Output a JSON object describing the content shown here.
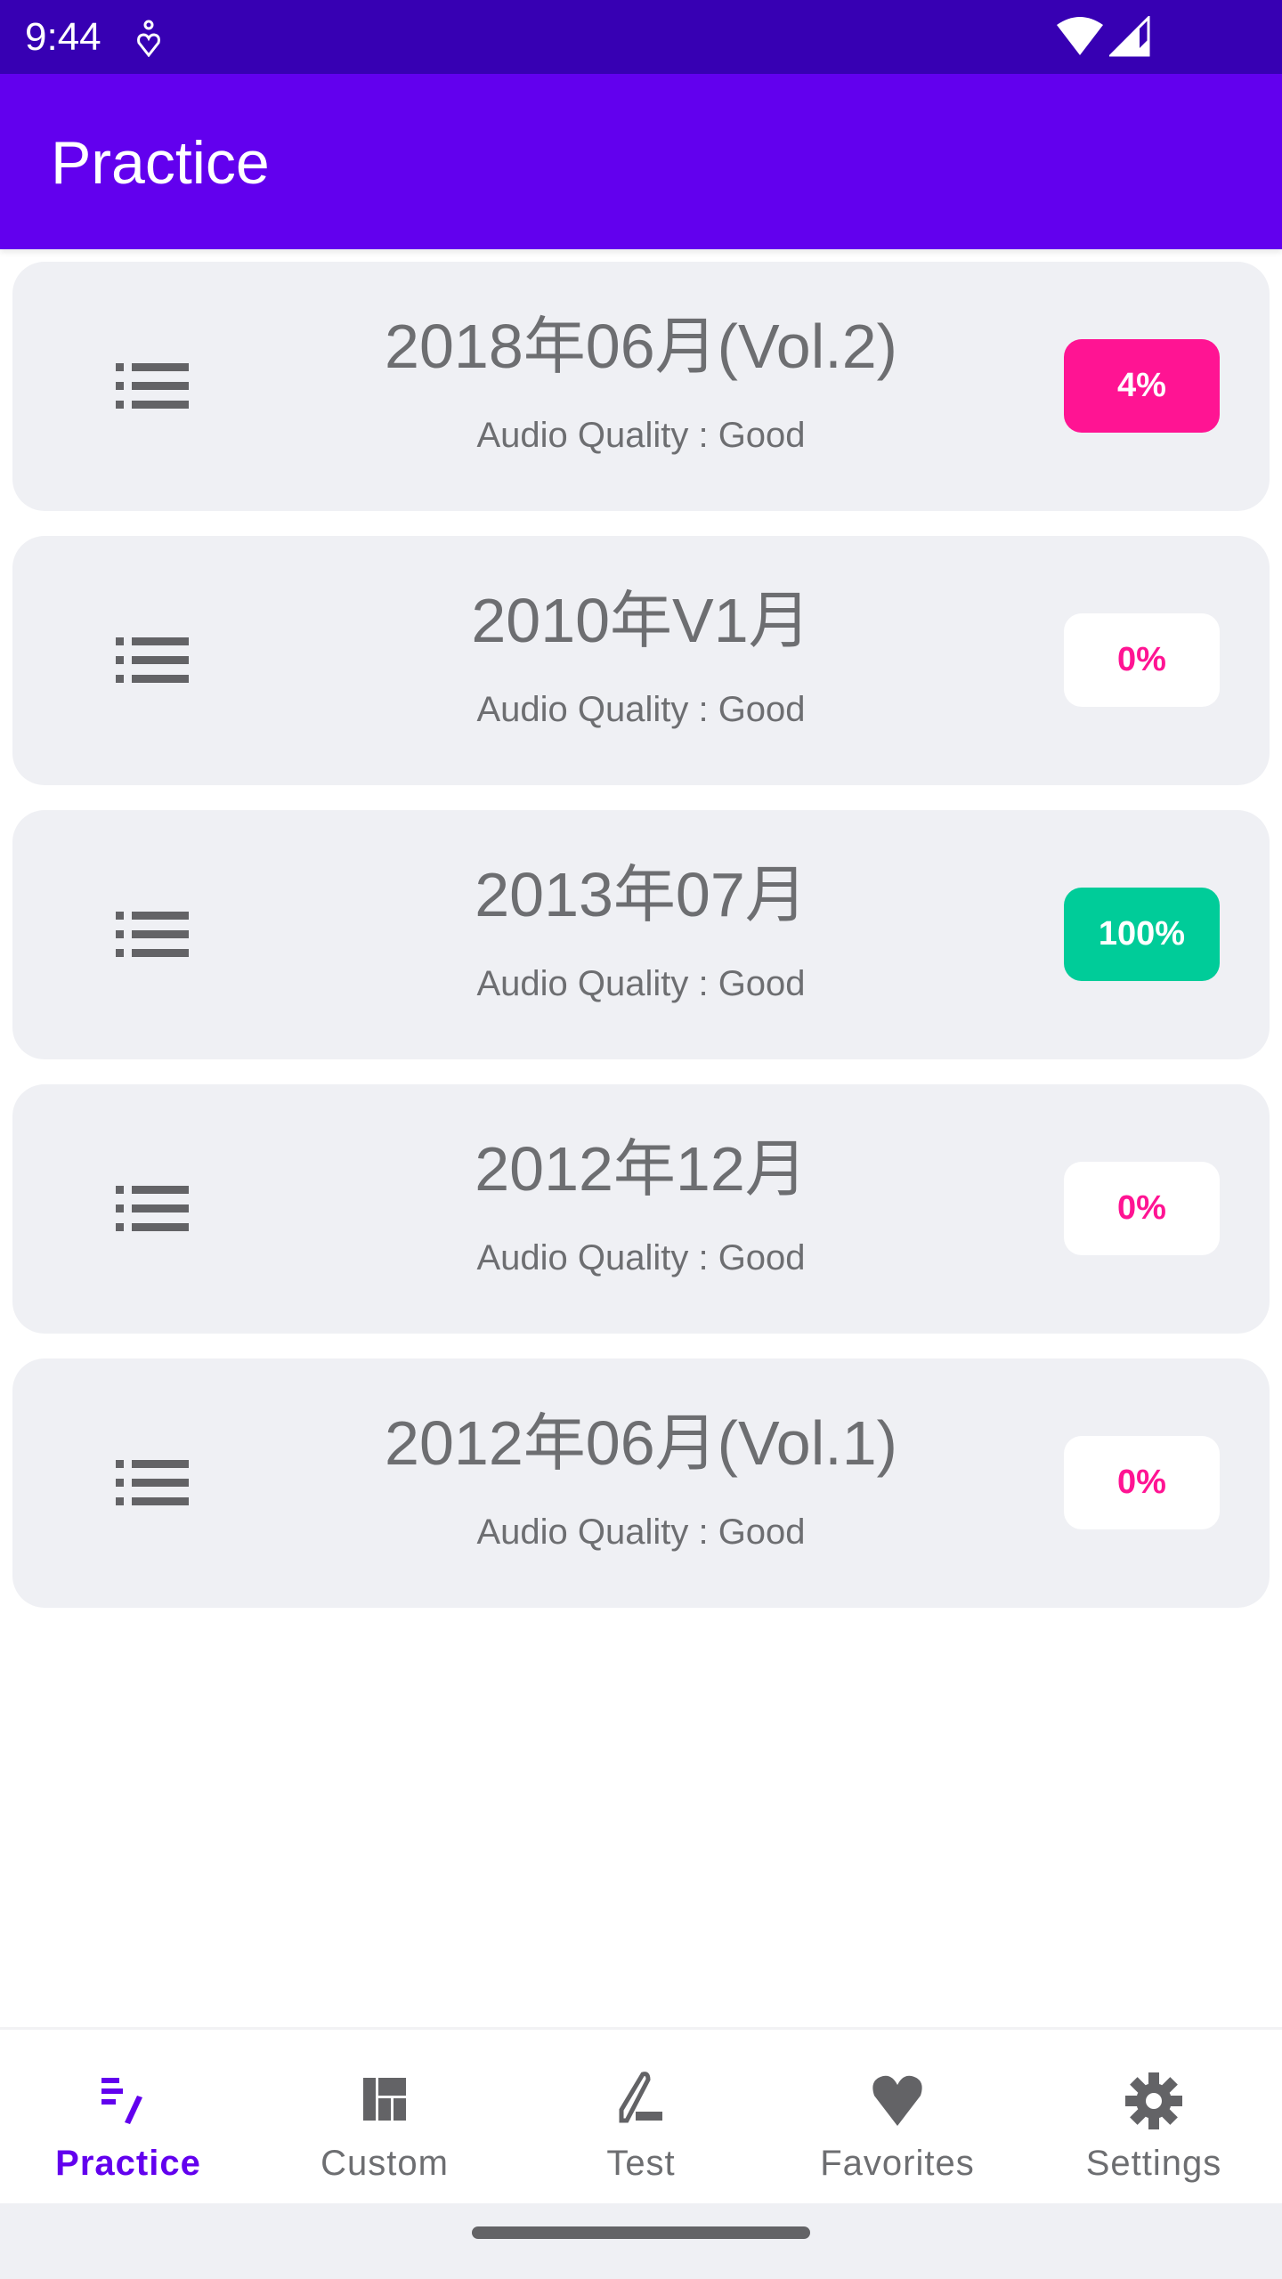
{
  "status_bar": {
    "time": "9:44",
    "icons": [
      "notification-icon",
      "wifi-icon",
      "signal-icon"
    ]
  },
  "app_bar": {
    "title": "Practice",
    "color": "#6200ee",
    "status_color": "#3700b3"
  },
  "items": [
    {
      "title": "2018年06月(Vol.2)",
      "subtitle": "Audio Quality : Good",
      "progress": "4%",
      "progress_value": 4,
      "badge_style": "filled-pink",
      "icon": "list-icon"
    },
    {
      "title": "2010年V1月",
      "subtitle": "Audio Quality : Good",
      "progress": "0%",
      "progress_value": 0,
      "badge_style": "outline-pink",
      "icon": "list-icon"
    },
    {
      "title": "2013年07月",
      "subtitle": "Audio Quality : Good",
      "progress": "100%",
      "progress_value": 100,
      "badge_style": "filled-green",
      "icon": "list-icon"
    },
    {
      "title": "2012年12月",
      "subtitle": "Audio Quality : Good",
      "progress": "0%",
      "progress_value": 0,
      "badge_style": "outline-pink",
      "icon": "list-icon"
    },
    {
      "title": "2012年06月(Vol.1)",
      "subtitle": "Audio Quality : Good",
      "progress": "0%",
      "progress_value": 0,
      "badge_style": "outline-pink",
      "icon": "list-icon"
    }
  ],
  "colors": {
    "pink": "#ff1493",
    "green": "#00cc99",
    "white": "#ffffff"
  },
  "bottom_nav": {
    "items": [
      {
        "label": "Practice",
        "icon": "practice-edit-list-icon",
        "active": true
      },
      {
        "label": "Custom",
        "icon": "dashboard-grid-icon",
        "active": false
      },
      {
        "label": "Test",
        "icon": "pencil-icon",
        "active": false
      },
      {
        "label": "Favorites",
        "icon": "heart-icon",
        "active": false
      },
      {
        "label": "Settings",
        "icon": "gear-icon",
        "active": false
      }
    ]
  }
}
